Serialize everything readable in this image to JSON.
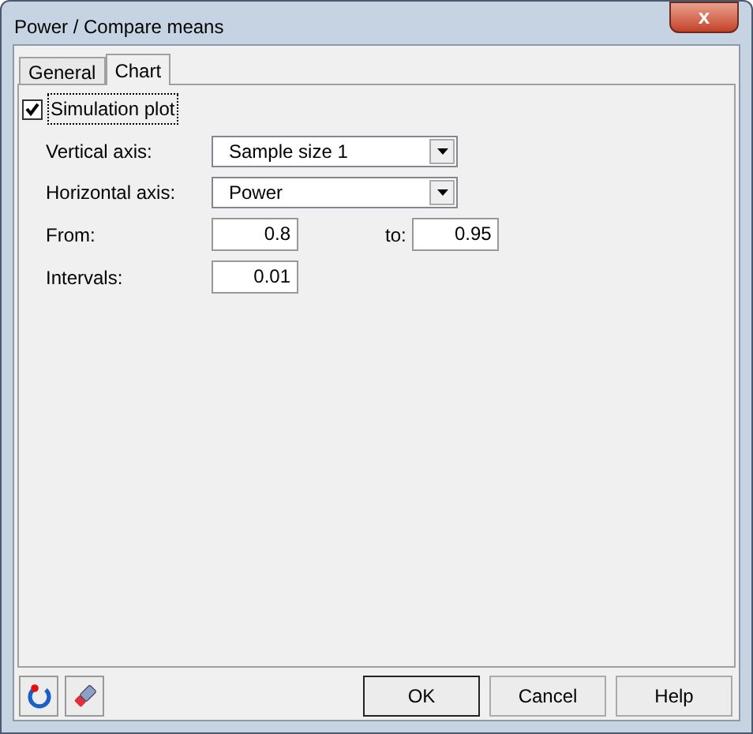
{
  "window": {
    "title": "Power / Compare means",
    "close": "x"
  },
  "tabs": [
    {
      "label": "General",
      "selected": false
    },
    {
      "label": "Chart",
      "selected": true
    }
  ],
  "simulation_plot": {
    "label": "Simulation plot",
    "checked": true
  },
  "vertical_axis": {
    "label": "Vertical axis:",
    "value": "Sample size 1"
  },
  "horizontal_axis": {
    "label": "Horizontal axis:",
    "value": "Power"
  },
  "from": {
    "label": "From:",
    "value": "0.8"
  },
  "to": {
    "label": "to:",
    "value": "0.95"
  },
  "intervals": {
    "label": "Intervals:",
    "value": "0.01"
  },
  "buttons": [
    "OK",
    "Cancel",
    "Help"
  ]
}
